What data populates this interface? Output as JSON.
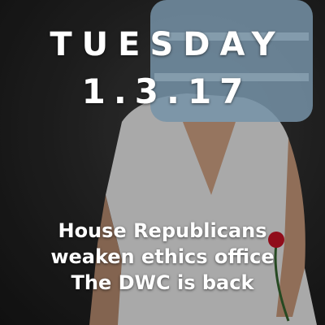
{
  "day": "TUESDAY",
  "date": "1.3.17",
  "headlines": [
    "House Republicans",
    "weaken ethics office",
    "The DWC is back"
  ],
  "colors": {
    "text": "#ffffff",
    "background": "#1c1c1c",
    "shirt": "#d9d9d9",
    "jug": "#8fb3cc",
    "rose": "#b01020"
  }
}
